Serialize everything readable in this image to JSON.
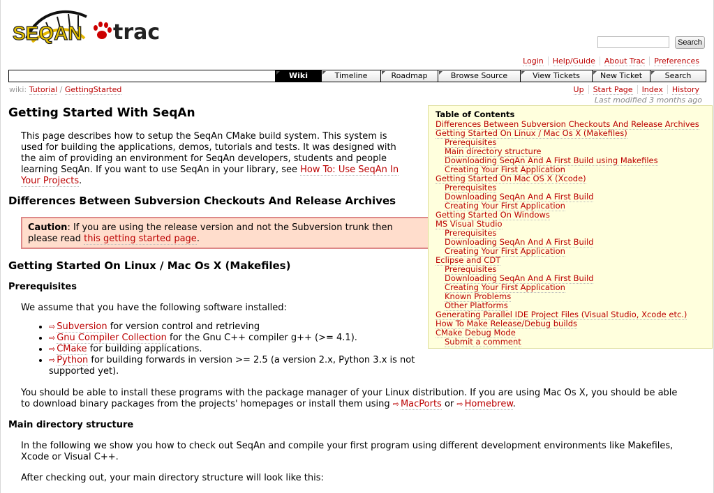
{
  "logo": {
    "text_left": "SEQAN",
    "text_right": "trac"
  },
  "search": {
    "placeholder": "",
    "value": "",
    "button_label": "Search"
  },
  "metanav": [
    "Login",
    "Help/Guide",
    "About Trac",
    "Preferences"
  ],
  "mainnav": [
    {
      "label": "Wiki",
      "active": true
    },
    {
      "label": "Timeline",
      "active": false
    },
    {
      "label": "Roadmap",
      "active": false
    },
    {
      "label": "Browse Source",
      "active": false
    },
    {
      "label": "View Tickets",
      "active": false
    },
    {
      "label": "New Ticket",
      "active": false
    },
    {
      "label": "Search",
      "active": false
    }
  ],
  "breadcrumb": {
    "prefix": "wiki:",
    "items": [
      "Tutorial",
      "GettingStarted"
    ],
    "sep": "/"
  },
  "ctxtnav": [
    "Up",
    "Start Page",
    "Index",
    "History"
  ],
  "last_modified": "Last modified 3 months ago",
  "page": {
    "title": "Getting Started With SeqAn",
    "intro_line1": "This page describes how to setup the SeqAn CMake build system. This system is",
    "intro_line2": "used for building the applications, demos, tutorials and tests. It was designed with",
    "intro_line3": "the aim of providing an environment for SeqAn developers, students and people",
    "intro_line4_a": "learning SeqAn. If you want to use SeqAn in your library, see ",
    "intro_link_a": "How To: Use SeqAn In",
    "intro_link_b": "Your Projects",
    "intro_end": ".",
    "h2_diff": "Differences Between Subversion Checkouts And Release Archives",
    "caution_label": "Caution",
    "caution_text1": ": If you are using the release version and not the Subversion trunk then",
    "caution_text2": "please read ",
    "caution_link": "this getting started page",
    "caution_end": ".",
    "h2_linux": "Getting Started On Linux / Mac Os X (Makefiles)",
    "h3_prereq": "Prerequisites",
    "prereq_text": "We assume that you have the following software installed:",
    "software": [
      {
        "link": "Subversion",
        "text": " for version control and retrieving"
      },
      {
        "link": "Gnu Compiler Collection",
        "text": " for the Gnu C++ compiler g++ (>= 4.1)."
      },
      {
        "link": "CMake",
        "text": " for building applications."
      },
      {
        "link": "Python",
        "text": " for building forwards in version >= 2.5 (a version 2.x, Python 3.x is not supported yet)."
      }
    ],
    "install_line1": "You should be able to install these programs with the package manager of your Linux distribution. If you are using Mac Os X, you should be able",
    "install_line2_a": "to download binary packages from the projects' homepages or install them using ",
    "install_link1": "MacPorts",
    "install_or": " or ",
    "install_link2": "Homebrew",
    "install_end": ".",
    "h3_maindir": "Main directory structure",
    "maindir_line1": "In the following we show you how to check out SeqAn and compile your first program using different development environments like Makefiles,",
    "maindir_line2": "Xcode or Visual C++.",
    "after_checkout": "After checking out, your main directory structure will look like this:"
  },
  "toc": {
    "title": "Table of Contents",
    "items": [
      {
        "level": 1,
        "label": "Differences Between Subversion Checkouts And Release Archives"
      },
      {
        "level": 1,
        "label": "Getting Started On Linux / Mac Os X (Makefiles)"
      },
      {
        "level": 2,
        "label": "Prerequisites"
      },
      {
        "level": 2,
        "label": "Main directory structure"
      },
      {
        "level": 2,
        "label": "Downloading SeqAn And A First Build using Makefiles"
      },
      {
        "level": 2,
        "label": "Creating Your First Application"
      },
      {
        "level": 1,
        "label": "Getting Started On Mac OS X (Xcode)"
      },
      {
        "level": 2,
        "label": "Prerequisites"
      },
      {
        "level": 2,
        "label": "Downloading SeqAn And A First Build"
      },
      {
        "level": 2,
        "label": "Creating Your First Application"
      },
      {
        "level": 1,
        "label": "Getting Started On Windows"
      },
      {
        "level": 1,
        "label": "MS Visual Studio"
      },
      {
        "level": 2,
        "label": "Prerequisites"
      },
      {
        "level": 2,
        "label": "Downloading SeqAn And A First Build"
      },
      {
        "level": 2,
        "label": "Creating Your First Application"
      },
      {
        "level": 1,
        "label": "Eclipse and CDT"
      },
      {
        "level": 2,
        "label": "Prerequisites"
      },
      {
        "level": 2,
        "label": "Downloading SeqAn And A First Build"
      },
      {
        "level": 2,
        "label": "Creating Your First Application"
      },
      {
        "level": 2,
        "label": "Known Problems"
      },
      {
        "level": 2,
        "label": "Other Platforms"
      },
      {
        "level": 1,
        "label": "Generating Parallel IDE Project Files (Visual Studio, Xcode etc.)"
      },
      {
        "level": 1,
        "label": "How To Make Release/Debug builds"
      },
      {
        "level": 1,
        "label": "CMake Debug Mode"
      },
      {
        "level": 2,
        "label": "Submit a comment"
      }
    ]
  },
  "colors": {
    "link": "#bb0000",
    "toc_bg": "#ffffdd",
    "caution_bg": "#ffddcc",
    "nav_active": "#000000"
  }
}
